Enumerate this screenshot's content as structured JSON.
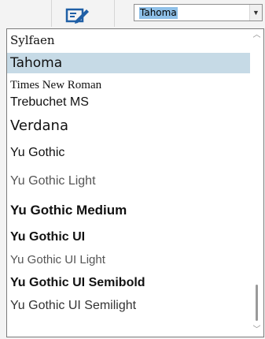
{
  "combo": {
    "value": "Tahoma"
  },
  "fonts": [
    {
      "label": "Sylfaen",
      "selected": false
    },
    {
      "label": "Tahoma",
      "selected": true
    },
    {
      "label": "Times New Roman",
      "selected": false
    },
    {
      "label": "Trebuchet MS",
      "selected": false
    },
    {
      "label": "Verdana",
      "selected": false
    },
    {
      "label": "Yu Gothic",
      "selected": false
    },
    {
      "label": "Yu Gothic Light",
      "selected": false
    },
    {
      "label": "Yu Gothic Medium",
      "selected": false
    },
    {
      "label": "Yu Gothic UI",
      "selected": false
    },
    {
      "label": "Yu Gothic UI Light",
      "selected": false
    },
    {
      "label": "Yu Gothic UI Semibold",
      "selected": false
    },
    {
      "label": "Yu Gothic UI Semilight",
      "selected": false
    }
  ],
  "colors": {
    "selection": "#c6dae6",
    "combo_highlight": "#8ec0e8",
    "icon_blue": "#1f5fa6"
  }
}
